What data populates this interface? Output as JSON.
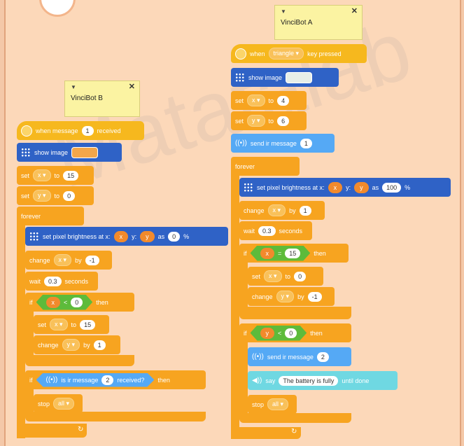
{
  "watermark": "Matatalab",
  "notes": {
    "b": "VinciBot B",
    "a": "VinciBot A"
  },
  "b": {
    "event": {
      "pre": "when message",
      "n": "1",
      "post": "received"
    },
    "show": "show image",
    "set1": {
      "lbl": "set",
      "var": "x ▾",
      "to": "to",
      "val": "15"
    },
    "set2": {
      "lbl": "set",
      "var": "y ▾",
      "to": "to",
      "val": "0"
    },
    "forever": "forever",
    "pix": {
      "lbl": "set pixel brightness at x:",
      "x": "x",
      "ylbl": "y:",
      "y": "y",
      "as": "as",
      "val": "0",
      "pct": "%"
    },
    "chg": {
      "lbl": "change",
      "var": "x ▾",
      "by": "by",
      "val": "-1"
    },
    "wait": {
      "lbl": "wait",
      "val": "0.3",
      "unit": "seconds"
    },
    "if1": {
      "if": "if",
      "l": "x",
      "op": "<",
      "r": "0",
      "then": "then"
    },
    "set3": {
      "lbl": "set",
      "var": "x ▾",
      "to": "to",
      "val": "15"
    },
    "chg2": {
      "lbl": "change",
      "var": "y ▾",
      "by": "by",
      "val": "1"
    },
    "if2": {
      "if": "if",
      "cond": "is ir message",
      "n": "2",
      "post": "received?",
      "then": "then"
    },
    "stop": {
      "lbl": "stop",
      "opt": "all ▾"
    }
  },
  "a": {
    "event": {
      "pre": "when",
      "key": "triangle ▾",
      "post": "key pressed"
    },
    "show": "show image",
    "set1": {
      "lbl": "set",
      "var": "x ▾",
      "to": "to",
      "val": "4"
    },
    "set2": {
      "lbl": "set",
      "var": "y ▾",
      "to": "to",
      "val": "6"
    },
    "send": {
      "lbl": "send ir message",
      "val": "1"
    },
    "forever": "forever",
    "pix": {
      "lbl": "set pixel brightness at x:",
      "x": "x",
      "ylbl": "y:",
      "y": "y",
      "as": "as",
      "val": "100",
      "pct": "%"
    },
    "chg": {
      "lbl": "change",
      "var": "x ▾",
      "by": "by",
      "val": "1"
    },
    "wait": {
      "lbl": "wait",
      "val": "0.3",
      "unit": "seconds"
    },
    "if1": {
      "if": "if",
      "l": "x",
      "op": "=",
      "r": "15",
      "then": "then"
    },
    "set3": {
      "lbl": "set",
      "var": "x ▾",
      "to": "to",
      "val": "0"
    },
    "chg2": {
      "lbl": "change",
      "var": "y ▾",
      "by": "by",
      "val": "-1"
    },
    "if2": {
      "if": "if",
      "l": "y",
      "op": "<",
      "r": "0",
      "then": "then"
    },
    "send2": {
      "lbl": "send ir message",
      "val": "2"
    },
    "say": {
      "lbl": "say",
      "text": "The battery is fully",
      "post": "until done"
    },
    "stop": {
      "lbl": "stop",
      "opt": "all ▾"
    }
  },
  "colors": {
    "event": "#f6b81e",
    "control": "#f7a420",
    "looks": "#2f62c6",
    "ir": "#55a9f5",
    "sound": "#6fd8e2",
    "operator": "#5dbb3b"
  },
  "images": {
    "b_image": "#f3a64a",
    "a_image": "#e8efe8"
  }
}
